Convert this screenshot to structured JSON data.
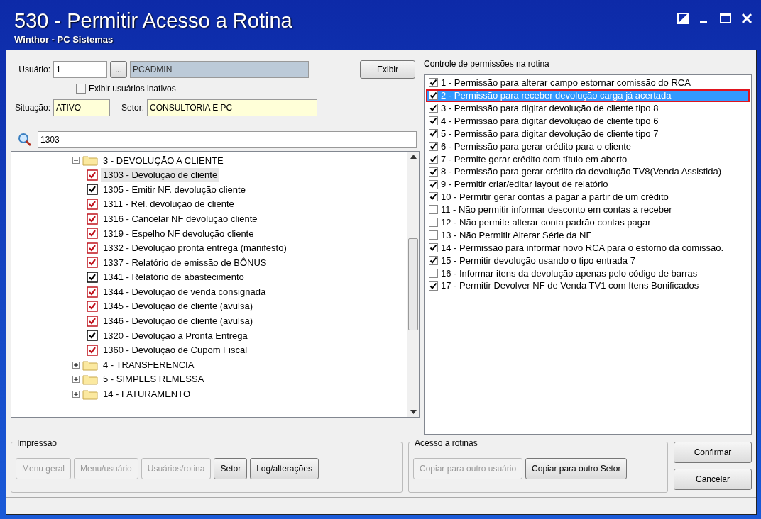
{
  "window": {
    "title": "530 - Permitir Acesso a Rotina",
    "subtitle": "Winthor - PC Sistemas"
  },
  "user": {
    "label": "Usuário:",
    "code": "1",
    "lookup_button": "...",
    "name": "PCADMIN",
    "show_button": "Exibir",
    "inactive_checkbox": {
      "label": "Exibir usuários inativos",
      "checked": false
    },
    "status_label": "Situação:",
    "status": "ATIVO",
    "sector_label": "Setor:",
    "sector": "CONSULTORIA E PC"
  },
  "search": {
    "value": "1303"
  },
  "tree": [
    {
      "label": "3 - DEVOLUÇÃO A CLIENTE",
      "expanded": true,
      "children": [
        {
          "label": "1303 - Devolução de cliente",
          "checked": true,
          "modified": true,
          "selected": true
        },
        {
          "label": "1305 - Emitir NF. devolução cliente",
          "checked": true,
          "modified": false,
          "selected": false
        },
        {
          "label": "1311 - Rel. devolução de cliente",
          "checked": true,
          "modified": true,
          "selected": false
        },
        {
          "label": "1316 - Cancelar NF devolução cliente",
          "checked": true,
          "modified": true,
          "selected": false
        },
        {
          "label": "1319 - Espelho NF devolução cliente",
          "checked": true,
          "modified": true,
          "selected": false
        },
        {
          "label": "1332 - Devolução pronta entrega (manifesto)",
          "checked": true,
          "modified": true,
          "selected": false
        },
        {
          "label": "1337 - Relatório de emissão de BÔNUS",
          "checked": true,
          "modified": true,
          "selected": false
        },
        {
          "label": "1341 - Relatório de abastecimento",
          "checked": true,
          "modified": false,
          "selected": false
        },
        {
          "label": "1344 - Devolução de venda consignada",
          "checked": true,
          "modified": true,
          "selected": false
        },
        {
          "label": "1345 - Devolução de cliente (avulsa)",
          "checked": true,
          "modified": true,
          "selected": false
        },
        {
          "label": "1346 - Devolução de cliente (avulsa)",
          "checked": true,
          "modified": true,
          "selected": false
        },
        {
          "label": "1320 - Devolução a Pronta Entrega",
          "checked": true,
          "modified": false,
          "selected": false
        },
        {
          "label": "1360 - Devolução de Cupom Fiscal",
          "checked": true,
          "modified": true,
          "selected": false
        }
      ]
    },
    {
      "label": "4 - TRANSFERENCIA",
      "expanded": false
    },
    {
      "label": "5 - SIMPLES REMESSA",
      "expanded": false
    },
    {
      "label": "14 - FATURAMENTO",
      "expanded": false
    }
  ],
  "permissions": {
    "title": "Controle de permissões na rotina",
    "items": [
      {
        "label": "1 - Permissão para alterar campo estornar comissão do RCA",
        "checked": true,
        "selected": false
      },
      {
        "label": "2 - Permissão para receber devolução carga já acertada",
        "checked": true,
        "selected": true
      },
      {
        "label": "3 - Permissão para digitar devolução de cliente tipo 8",
        "checked": true,
        "selected": false
      },
      {
        "label": "4 - Permissão para digitar devolução de cliente tipo 6",
        "checked": true,
        "selected": false
      },
      {
        "label": "5 - Permissão para digitar devolução de cliente tipo 7",
        "checked": true,
        "selected": false
      },
      {
        "label": "6 - Permissão para gerar crédito para o cliente",
        "checked": true,
        "selected": false
      },
      {
        "label": "7 - Permite gerar crédito com título em aberto",
        "checked": true,
        "selected": false
      },
      {
        "label": "8 - Permissão para gerar crédito da devolução TV8(Venda Assistida)",
        "checked": true,
        "selected": false
      },
      {
        "label": "9 - Permitir criar/editar layout de relatório",
        "checked": true,
        "selected": false
      },
      {
        "label": "10 - Permitir gerar contas a pagar a partir de um crédito",
        "checked": true,
        "selected": false
      },
      {
        "label": "11 - Não permitir informar desconto em contas a receber",
        "checked": false,
        "selected": false
      },
      {
        "label": "12 - Não permite alterar conta padrão contas pagar",
        "checked": false,
        "selected": false
      },
      {
        "label": "13 - Não Permitir Alterar Série da NF",
        "checked": false,
        "selected": false
      },
      {
        "label": "14 - Permissão para informar novo RCA para o estorno da comissão.",
        "checked": true,
        "selected": false
      },
      {
        "label": "15 - Permitir devolução usando o tipo entrada 7",
        "checked": true,
        "selected": false
      },
      {
        "label": "16 - Informar itens da devolução apenas pelo código de barras",
        "checked": false,
        "selected": false
      },
      {
        "label": "17 - Permitir Devolver NF de Venda TV1 com Itens Bonificados",
        "checked": true,
        "selected": false
      }
    ]
  },
  "print_group": {
    "title": "Impressão",
    "buttons": [
      {
        "label": "Menu geral",
        "disabled": true
      },
      {
        "label": "Menu/usuário",
        "disabled": true
      },
      {
        "label": "Usuários/rotina",
        "disabled": true
      },
      {
        "label": "Setor",
        "disabled": false
      },
      {
        "label": "Log/alterações",
        "disabled": false
      }
    ]
  },
  "access_group": {
    "title": "Acesso a rotinas",
    "buttons": [
      {
        "label": "Copiar para outro usuário",
        "disabled": true
      },
      {
        "label": "Copiar para outro Setor",
        "disabled": false
      }
    ]
  },
  "actions": [
    {
      "label": "Confirmar"
    },
    {
      "label": "Cancelar"
    }
  ]
}
